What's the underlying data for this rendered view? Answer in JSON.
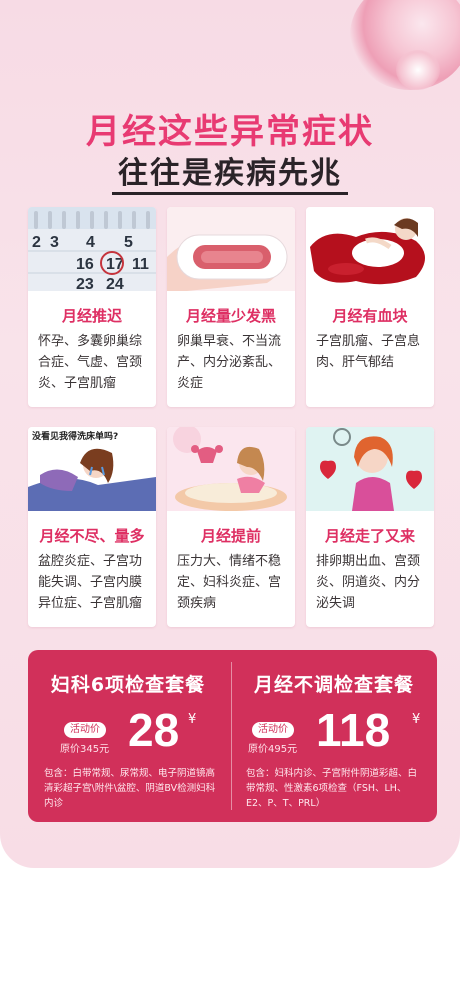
{
  "headline": {
    "line1": "月经这些异常症状",
    "line2": "往往是疾病先兆"
  },
  "cards": [
    {
      "title": "月经推迟",
      "desc": "怀孕、多囊卵巢综合症、气虚、宫颈炎、子宫肌瘤",
      "image": "calendar-photo"
    },
    {
      "title": "月经量少发黑",
      "desc": "卵巢早衰、不当流产、内分泌紊乱、炎症",
      "image": "sanitary-pad-photo"
    },
    {
      "title": "月经有血块",
      "desc": "子宫肌瘤、子宫息肉、肝气郁结",
      "image": "blood-illustration"
    },
    {
      "title": "月经不尽、量多",
      "desc": "盆腔炎症、子宫功能失调、子宫内膜异位症、子宫肌瘤",
      "image": "crying-girl-illustration",
      "image_caption": "没看见我得洗床单吗?"
    },
    {
      "title": "月经提前",
      "desc": "压力大、情绪不稳定、妇科炎症、宫颈疾病",
      "image": "uterus-girl-illustration"
    },
    {
      "title": "月经走了又来",
      "desc": "排卵期出血、宫颈炎、阴道炎、内分泌失调",
      "image": "sad-girl-heart-illustration"
    }
  ],
  "offers": [
    {
      "name": "妇科6项检查套餐",
      "badge": "活动价",
      "original": "原价345元",
      "price": "28",
      "currency": "¥",
      "includes": "包含：白带常规、尿常规、电子阴道镜高清彩超子宫\\附件\\盆腔、阴道BV检测妇科内诊"
    },
    {
      "name": "月经不调检查套餐",
      "badge": "活动价",
      "original": "原价495元",
      "price": "118",
      "currency": "¥",
      "includes": "包含：妇科内诊、子宫附件阴道彩超、白带常规、性激素6项检查（FSH、LH、E2、P、T、PRL）"
    }
  ],
  "colors": {
    "accent": "#e83a72",
    "card_title": "#de2f63",
    "offer_bg": "#d1305a",
    "background": "#f8dde6"
  }
}
